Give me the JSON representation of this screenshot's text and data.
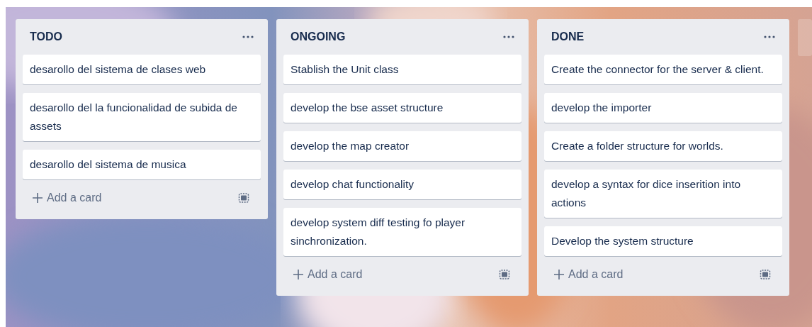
{
  "lists": [
    {
      "title": "TODO",
      "cards": [
        "desarollo del sistema de clases web",
        "desarollo del la funcionalidad de subida de assets",
        "desarollo del sistema de musica"
      ],
      "add_label": "Add a card"
    },
    {
      "title": "ONGOING",
      "cards": [
        "Stablish the Unit class",
        "develop the bse asset structure",
        "develop the map creator",
        "develop chat functionality",
        "develop system diff testing fo player sinchronization."
      ],
      "add_label": "Add a card"
    },
    {
      "title": "DONE",
      "cards": [
        "Create the connector for the server & client.",
        "develop the importer",
        "Create a folder structure for worlds.",
        "develop a syntax for dice inserition into actions",
        "Develop the system structure"
      ],
      "add_label": "Add a card"
    }
  ]
}
